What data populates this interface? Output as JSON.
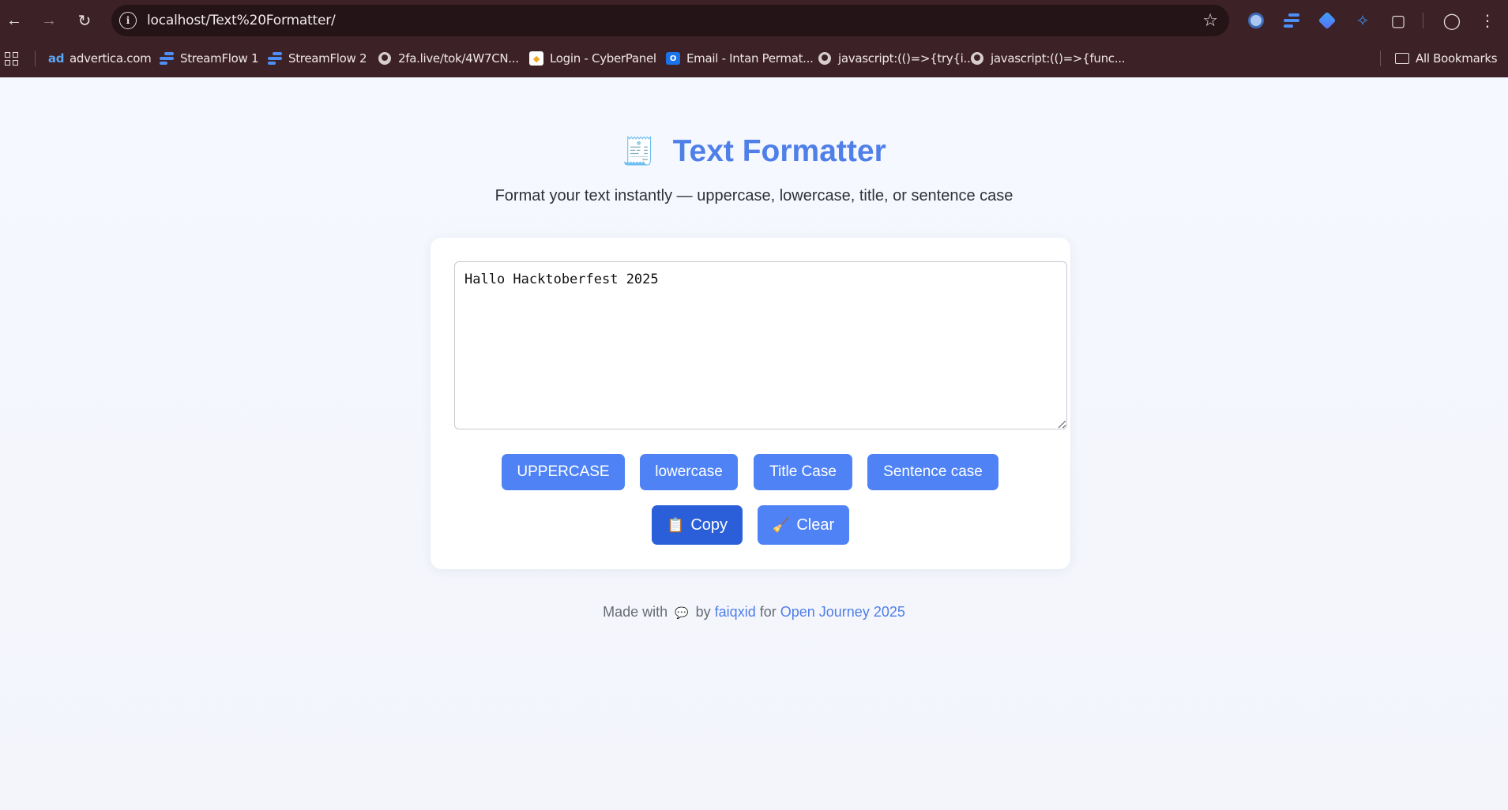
{
  "browser": {
    "url": "localhost/Text%20Formatter/",
    "bookmarks": [
      {
        "label": "advertica.com",
        "icon": "advertica-icon"
      },
      {
        "label": "StreamFlow 1",
        "icon": "streamflow-icon"
      },
      {
        "label": "StreamFlow 2",
        "icon": "streamflow-icon"
      },
      {
        "label": "2fa.live/tok/4W7CN...",
        "icon": "globe-icon"
      },
      {
        "label": "Login - CyberPanel",
        "icon": "cyberpanel-icon"
      },
      {
        "label": "Email - Intan Permat...",
        "icon": "outlook-icon"
      },
      {
        "label": "javascript:(()=>{try{i...",
        "icon": "globe-icon"
      },
      {
        "label": "javascript:(()=>{func...",
        "icon": "globe-icon"
      }
    ],
    "all_bookmarks": "All Bookmarks"
  },
  "app": {
    "icon": "🧾",
    "title": "Text Formatter",
    "subtitle": "Format your text instantly — uppercase, lowercase, title, or sentence case",
    "input_value": "Hallo Hacktoberfest 2025",
    "buttons": {
      "uppercase": "UPPERCASE",
      "lowercase": "lowercase",
      "titlecase": "Title Case",
      "sentencecase": "Sentence case",
      "copy_icon": "📋",
      "copy": "Copy",
      "clear_icon": "🧹",
      "clear": "Clear"
    }
  },
  "footer": {
    "made_with": "Made with",
    "heart": "💬",
    "by": "by",
    "author": "faiqxid",
    "for": "for",
    "event": "Open Journey 2025"
  }
}
